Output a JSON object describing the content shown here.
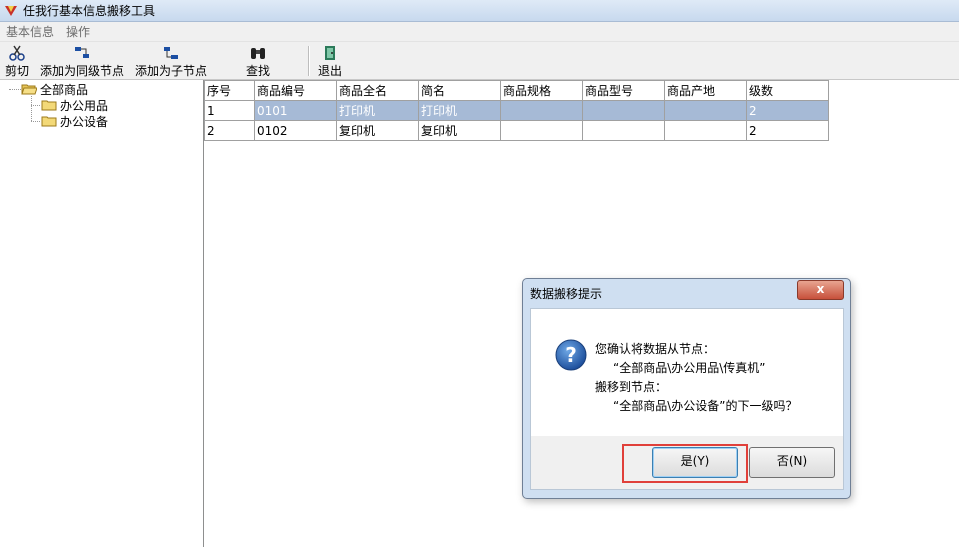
{
  "window": {
    "title": "任我行基本信息搬移工具"
  },
  "menu": [
    {
      "label": "基本信息"
    },
    {
      "label": "操作"
    }
  ],
  "toolbar": {
    "cut": "剪切",
    "add_sibling": "添加为同级节点",
    "add_child": "添加为子节点",
    "find": "查找",
    "exit": "退出"
  },
  "tree": {
    "root": "全部商品",
    "children": [
      "办公用品",
      "办公设备"
    ]
  },
  "grid": {
    "headers": [
      "序号",
      "商品编号",
      "商品全名",
      "简名",
      "商品规格",
      "商品型号",
      "商品产地",
      "级数"
    ],
    "rows": [
      [
        "1",
        "0101",
        "打印机",
        "打印机",
        "",
        "",
        "",
        "2"
      ],
      [
        "2",
        "0102",
        "复印机",
        "复印机",
        "",
        "",
        "",
        "2"
      ]
    ],
    "selected_row": 0
  },
  "dialog": {
    "title": "数据搬移提示",
    "close": "x",
    "line1": "您确认将数据从节点：",
    "line2": "“全部商品\\办公用品\\传真机”",
    "line3": "搬移到节点：",
    "line4": "“全部商品\\办公设备”的下一级吗？",
    "yes": "是(Y)",
    "no": "否(N)"
  },
  "colors": {
    "selection": "#a6bad6",
    "highlight_border": "#e0403a"
  }
}
